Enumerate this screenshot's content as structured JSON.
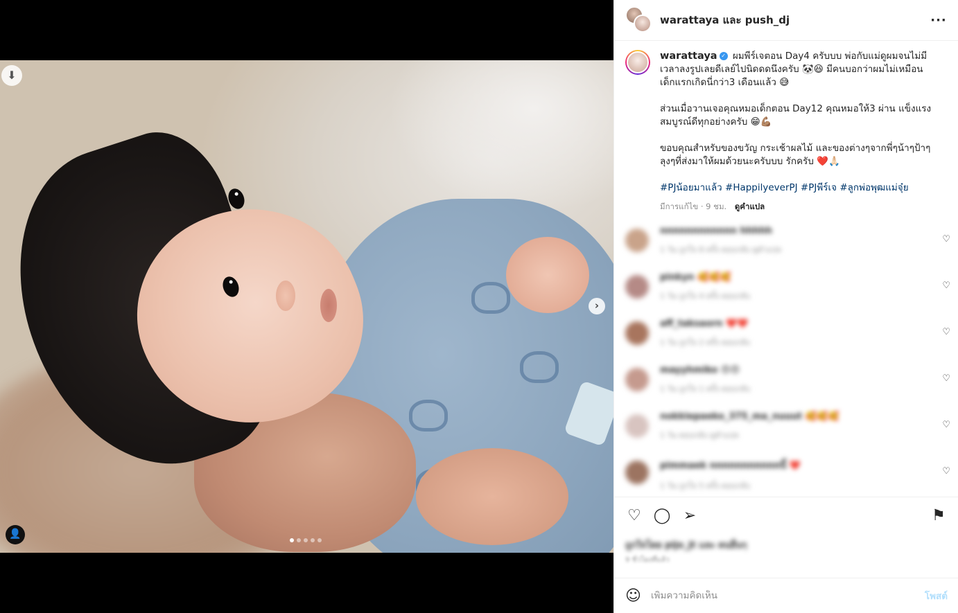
{
  "header": {
    "names": "warattaya และ push_dj",
    "more_icon": "more-horizontal-icon"
  },
  "caption": {
    "username": "warattaya",
    "paragraph1": "ผมพีร์เจตอน Day4 ครับบบ พ่อกับแม่ดูผมจนไม่มีเวลาลงรูปเลยดีเลย์ไปนิดดดนึงครับ 🐼😆 มีคนบอกว่าผมไม่เหมือนเด็กแรกเกิดนี่กว่า3 เดือนแล้ว 😅",
    "paragraph2": "ส่วนเมื่อวานเจอคุณหมอเด็กตอน Day12 คุณหมอให้3 ผ่าน แข็งแรงสมบูรณ์ดีทุกอย่างครับ 😁💪🏽",
    "paragraph3": "ขอบคุณสำหรับของขวัญ กระเช้าผลไม้ และของต่างๆจากพี่ๆน้าๆป้าๆลุงๆที่ส่งมาให้ผมด้วยนะครับบบ รักครับ ❤️🙏🏻",
    "hashtags": "#PJน้อยมาแล้ว #HappilyeverPJ #PJพีร์เจ #ลูกพ่อพุฒแม่จุ๋ย",
    "meta": "มีการแก้ไข · 9 ชม.",
    "translate": "ดูคำแปล"
  },
  "comments": [
    {
      "user": "nnnnnnnnnnnn",
      "text": "hhhhh",
      "sub": "1 วัน   ถูกใจ 8 ครั้ง   ตอบกลับ   ดูคำแปล"
    },
    {
      "user": "pinkyn",
      "text": "🥰🥰🥰",
      "sub": "1 วัน   ถูกใจ 4 ครั้ง   ตอบกลับ"
    },
    {
      "user": "aff_taksaorn",
      "text": "❤️❤️",
      "sub": "1 วัน   ถูกใจ 2 ครั้ง   ตอบกลับ"
    },
    {
      "user": "mayyhmiko",
      "text": "😍😍",
      "sub": "1 วัน   ถูกใจ 1 ครั้ง   ตอบกลับ"
    },
    {
      "user": "nokkiepaeko_375_ma_nuuut",
      "text": "🥰🥰🥰",
      "sub": "1 วัน   ตอบกลับ   ดูคำแปล"
    },
    {
      "user": "pimmaek",
      "text": "nnnnnnnnnnnนี้ ❤️",
      "sub": "1 วัน   ถูกใจ 5 ครั้ง   ตอบกลับ"
    }
  ],
  "likes": "ถูกใจโดย pijo_jt และ คนอื่นๆ",
  "time_ago": "9 ชั่วโมงที่แล้ว",
  "add_comment": {
    "placeholder": "เพิ่มความคิดเห็น",
    "post_label": "โพสต์"
  },
  "carousel": {
    "total": 5,
    "active": 1
  }
}
